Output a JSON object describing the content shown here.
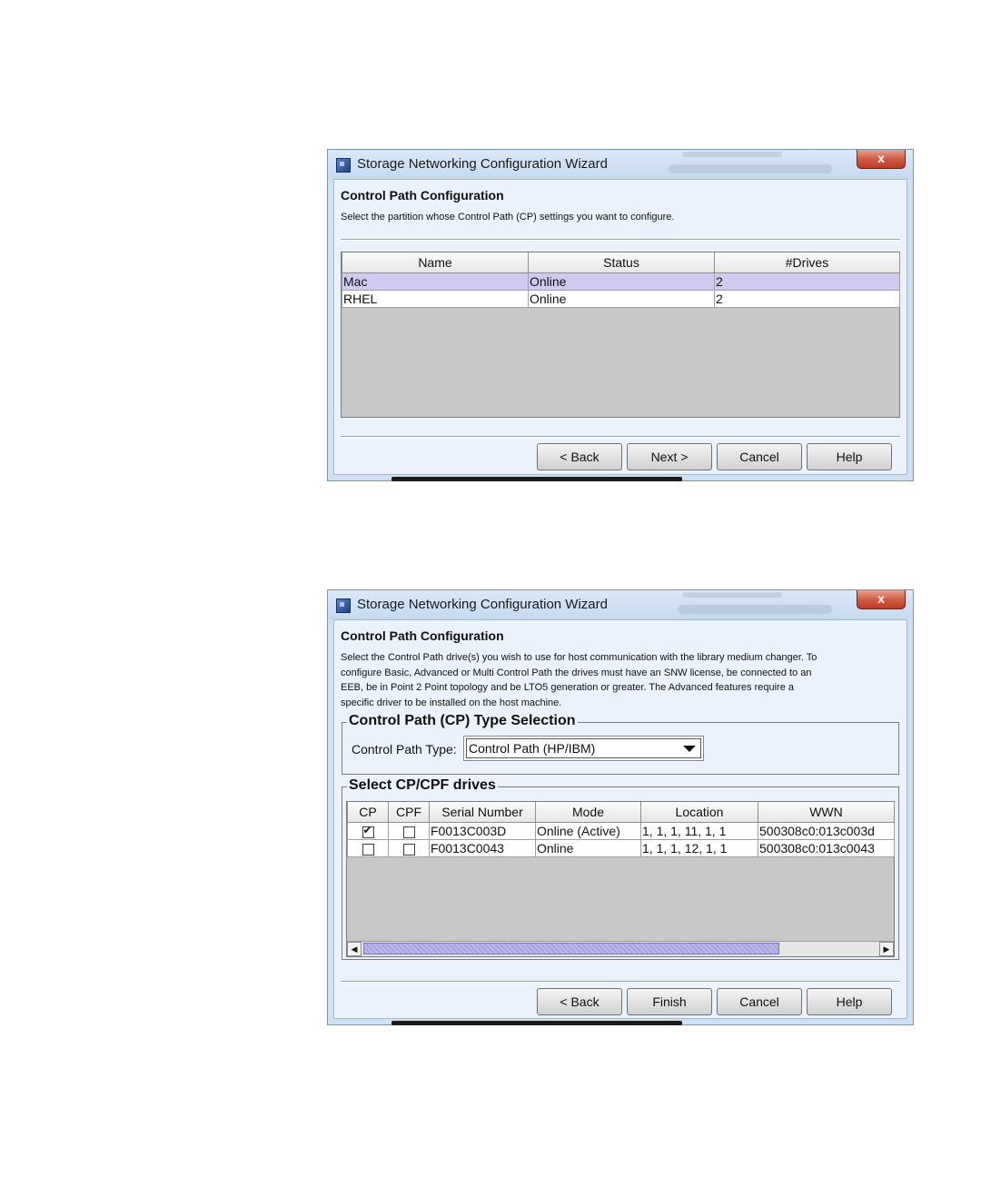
{
  "wizard1": {
    "title": "Storage Networking Configuration Wizard",
    "close_symbol": "x",
    "heading": "Control Path Configuration",
    "description": "Select the partition whose Control Path (CP) settings you want to configure.",
    "columns": [
      "Name",
      "Status",
      "#Drives"
    ],
    "rows": [
      {
        "name": "Mac",
        "status": "Online",
        "drives": "2",
        "selected": true
      },
      {
        "name": "RHEL",
        "status": "Online",
        "drives": "2",
        "selected": false
      }
    ],
    "buttons": {
      "back": "< Back",
      "next": "Next >",
      "cancel": "Cancel",
      "help": "Help"
    }
  },
  "wizard2": {
    "title": "Storage Networking Configuration Wizard",
    "close_symbol": "x",
    "heading": "Control Path Configuration",
    "description": [
      "Select the Control Path drive(s) you wish to use for host communication with the library medium changer. To",
      "configure Basic, Advanced or Multi Control Path the drives must have an SNW license, be connected to an",
      "EEB, be in Point 2 Point topology and be LTO5 generation or greater. The Advanced features require a",
      "specific driver to be installed on the host machine."
    ],
    "type_selection": {
      "legend": "Control Path (CP) Type Selection",
      "label": "Control Path Type:",
      "selected": "Control Path (HP/IBM)"
    },
    "drives": {
      "legend": "Select CP/CPF drives",
      "columns": [
        "CP",
        "CPF",
        "Serial Number",
        "Mode",
        "Location",
        "WWN"
      ],
      "rows": [
        {
          "cp": true,
          "cpf": false,
          "serial": "F0013C003D",
          "mode": "Online (Active)",
          "location": "1, 1, 1, 11, 1, 1",
          "wwn": "500308c0:013c003d"
        },
        {
          "cp": false,
          "cpf": false,
          "serial": "F0013C0043",
          "mode": "Online",
          "location": "1, 1, 1, 12, 1, 1",
          "wwn": "500308c0:013c0043"
        }
      ]
    },
    "buttons": {
      "back": "< Back",
      "finish": "Finish",
      "cancel": "Cancel",
      "help": "Help"
    }
  }
}
